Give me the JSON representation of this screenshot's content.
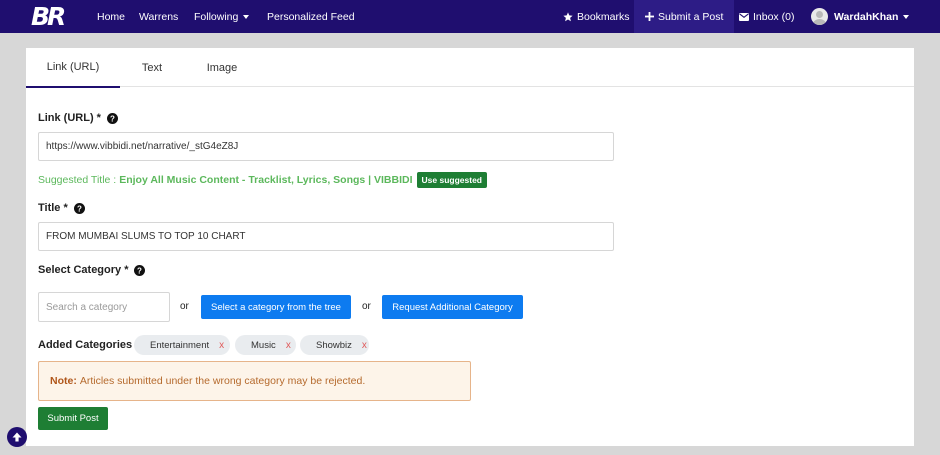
{
  "nav": {
    "logo": "BR",
    "links": [
      "Home",
      "Warrens",
      "Following",
      "Personalized Feed"
    ],
    "bookmarks": "Bookmarks",
    "submit": "Submit a Post",
    "inbox": "Inbox (0)",
    "username": "WardahKhan",
    "colors": {
      "bar": "#1f0e6f",
      "active": "#2d1c86"
    }
  },
  "tabs": [
    "Link (URL)",
    "Text",
    "Image"
  ],
  "form": {
    "url_label": "Link (URL) *",
    "url_value": "https://www.vibbidi.net/narrative/_stG4eZ8J",
    "suggest_prefix": "Suggested Title :",
    "suggest_title": "Enjoy All Music Content - Tracklist, Lyrics, Songs | VIBBIDI",
    "use_suggested": "Use suggested",
    "title_label": "Title *",
    "title_value": "FROM MUMBAI SLUMS TO TOP 10 CHART",
    "category_label": "Select Category *",
    "search_placeholder": "Search a category",
    "or1": "or",
    "tree_button": "Select a category from the tree",
    "or2": "or",
    "request_button": "Request Additional Category",
    "added_label": "Added Categories",
    "categories": [
      "Entertainment",
      "Music",
      "Showbiz"
    ],
    "remove_mark": "x",
    "note_strong": "Note:",
    "note_text": "Articles submitted under the wrong category may be rejected.",
    "submit_button": "Submit Post"
  },
  "icons": [
    "star-icon",
    "plus-icon",
    "envelope-icon",
    "avatar",
    "caret-down-icon",
    "question-circle-icon",
    "arrow-up-circle-icon"
  ]
}
